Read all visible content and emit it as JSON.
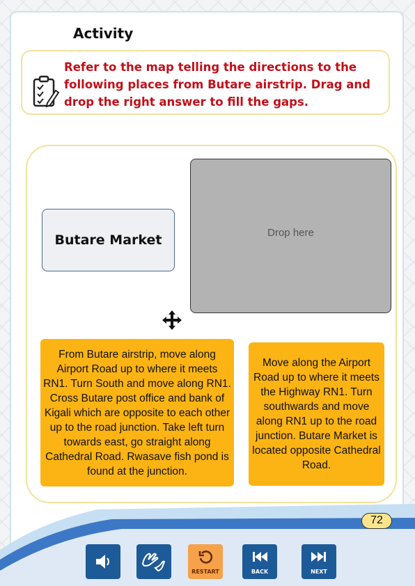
{
  "activity": {
    "title": "Activity",
    "instruction": "Refer to the map telling the directions to the following places from Butare airstrip. Drag and drop the right answer to fill the gaps."
  },
  "exercise": {
    "source_label": "Butare Market",
    "drop_placeholder": "Drop here",
    "answers": [
      "From Butare airstrip, move along Airport Road up to where it meets RN1. Turn South and move along RN1. Cross Butare post office and bank of Kigali which are opposite to each other up to the road junction. Take left turn towards east, go straight along Cathedral Road. Rwasave fish pond is found at the junction.",
      "Move along the Airport Road up to where it meets the Highway RN1. Turn southwards and move along RN1 up to the road junction. Butare Market is located opposite Cathedral Road."
    ]
  },
  "footer": {
    "page_number": "72",
    "restart_label": "RESTART",
    "back_label": "BACK",
    "next_label": "NEXT"
  },
  "colors": {
    "instruction_text": "#c0101a",
    "answer_bg": "#fbb413",
    "nav_button": "#1d5a98",
    "restart_button": "#f6a24a",
    "panel_border": "#f3e29a"
  },
  "icons": [
    "checklist-icon",
    "move-icon",
    "speaker-icon",
    "sign-language-icon",
    "restart-icon",
    "back-icon",
    "next-icon"
  ]
}
